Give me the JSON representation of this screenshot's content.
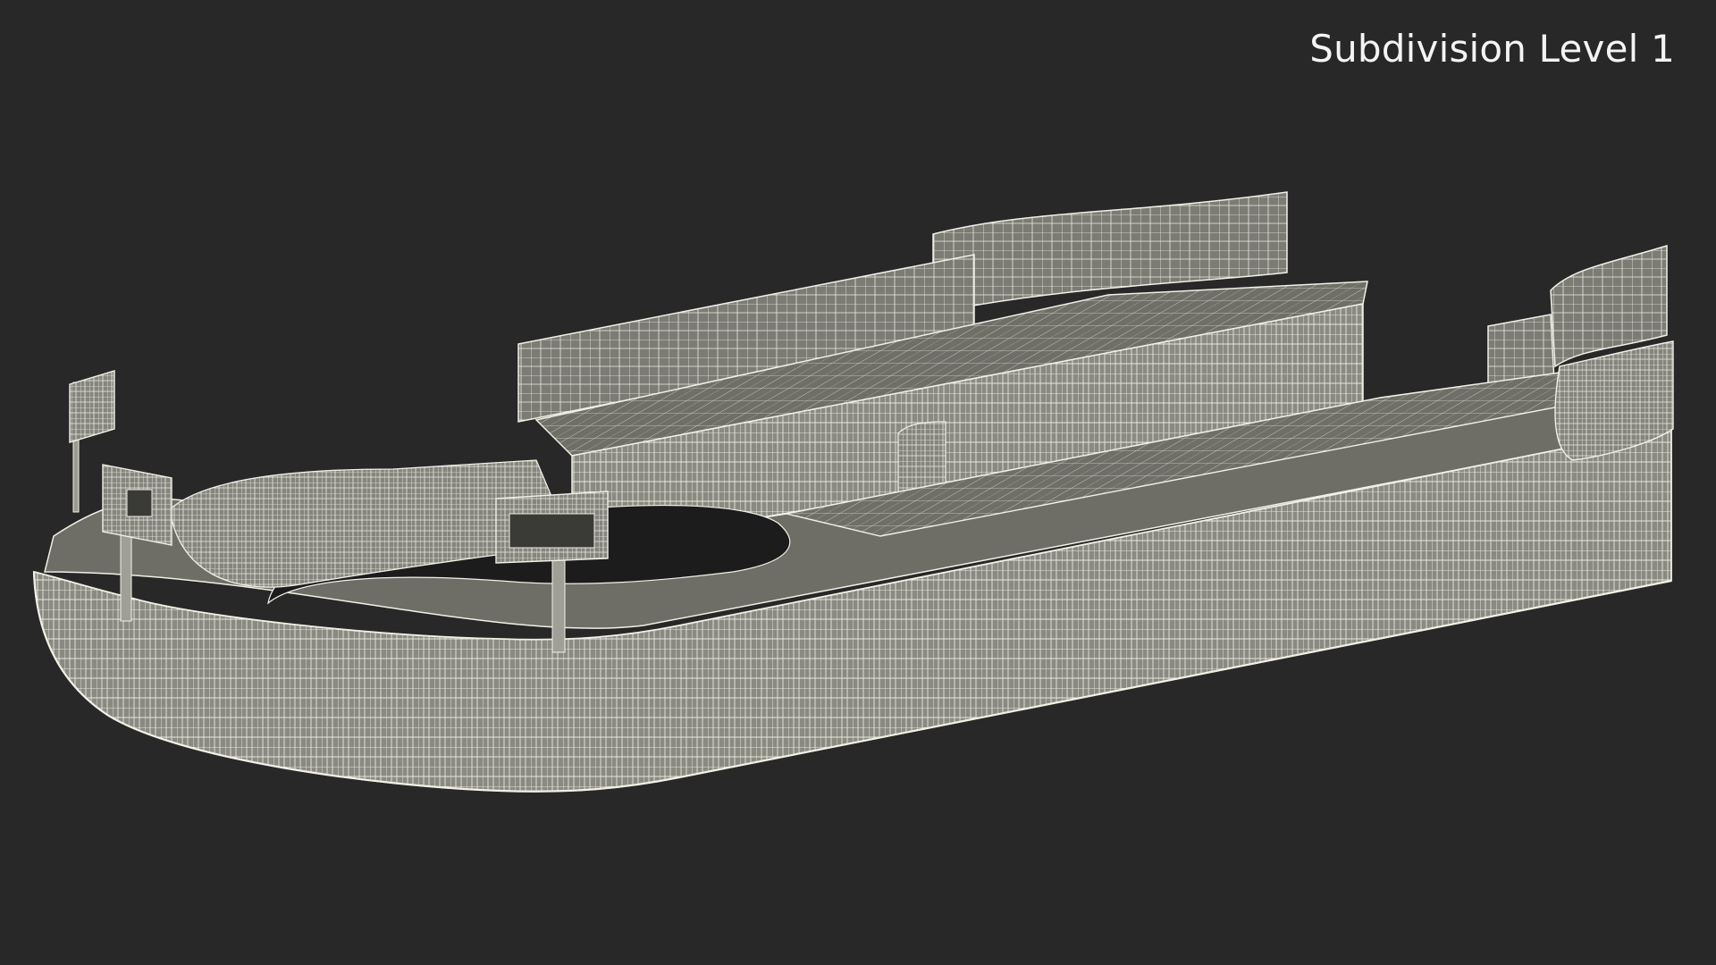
{
  "viewport": {
    "overlay_label": "Subdivision Level 1",
    "background_color": "#282828",
    "mesh_face_color": "#8c8c84",
    "wire_color": "#f2f0e6"
  },
  "model": {
    "icon": "wireframe-track-model"
  }
}
